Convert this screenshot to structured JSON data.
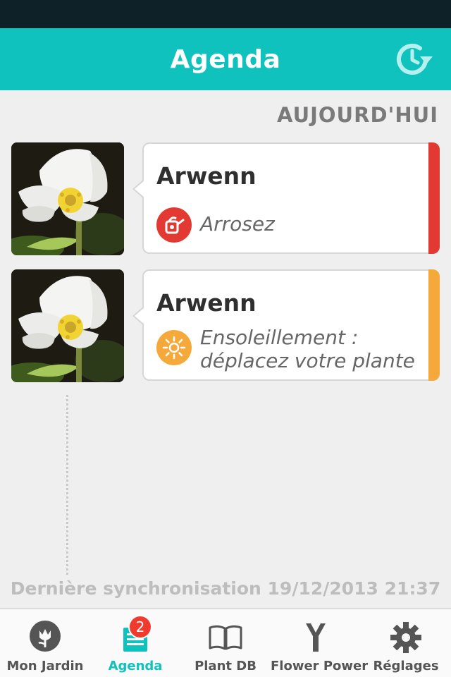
{
  "header": {
    "title": "Agenda",
    "sync_icon": "clock-sync-icon"
  },
  "today_label": "AUJOURD'HUI",
  "tasks": [
    {
      "plant": "Arwenn",
      "action": "Arrosez",
      "action_icon": "watering-can-icon",
      "accent": "#e23a33"
    },
    {
      "plant": "Arwenn",
      "action_line1": "Ensoleillement :",
      "action_line2": "déplacez votre plante",
      "action_icon": "sun-icon",
      "accent": "#f5a93b"
    }
  ],
  "footer": {
    "last_sync": "Dernière synchronisation 19/12/2013 21:37"
  },
  "tabs": [
    {
      "label": "Mon Jardin",
      "icon": "flower-icon"
    },
    {
      "label": "Agenda",
      "icon": "agenda-icon",
      "badge": "2",
      "active": true
    },
    {
      "label": "Plant DB",
      "icon": "book-icon"
    },
    {
      "label": "Flower Power",
      "icon": "sensor-icon"
    },
    {
      "label": "Réglages",
      "icon": "gear-icon"
    }
  ],
  "colors": {
    "primary": "#10c2bd",
    "status_bar": "#0e2129",
    "alert": "#e23a33",
    "warning": "#f5a93b"
  }
}
